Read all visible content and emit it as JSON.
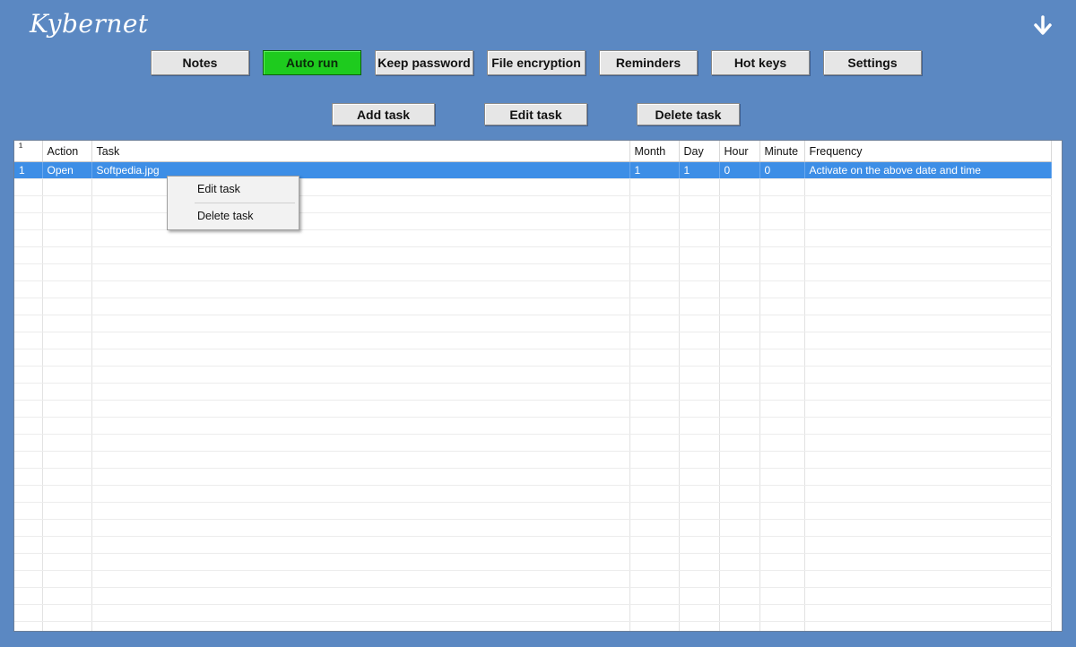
{
  "app": {
    "title": "Kybernet"
  },
  "nav": [
    {
      "label": "Notes",
      "active": false
    },
    {
      "label": "Auto run",
      "active": true
    },
    {
      "label": "Keep password",
      "active": false
    },
    {
      "label": "File encryption",
      "active": false
    },
    {
      "label": "Reminders",
      "active": false
    },
    {
      "label": "Hot keys",
      "active": false
    },
    {
      "label": "Settings",
      "active": false
    }
  ],
  "actions": {
    "add_label": "Add task",
    "edit_label": "Edit task",
    "delete_label": "Delete task"
  },
  "table": {
    "columns": [
      "¹",
      "Action",
      "Task",
      "Month",
      "Day",
      "Hour",
      "Minute",
      "Frequency"
    ],
    "rows": [
      [
        "1",
        "Open",
        "Softpedia.jpg",
        "1",
        "1",
        "0",
        "0",
        "Activate on the above date and time"
      ]
    ],
    "empty_rows": 27
  },
  "context_menu": {
    "items": [
      "Edit task",
      "Delete task"
    ]
  },
  "colors": {
    "background": "#5b88c2",
    "active_tab": "#1ecb1e",
    "selected_row": "#3d8ee6"
  }
}
